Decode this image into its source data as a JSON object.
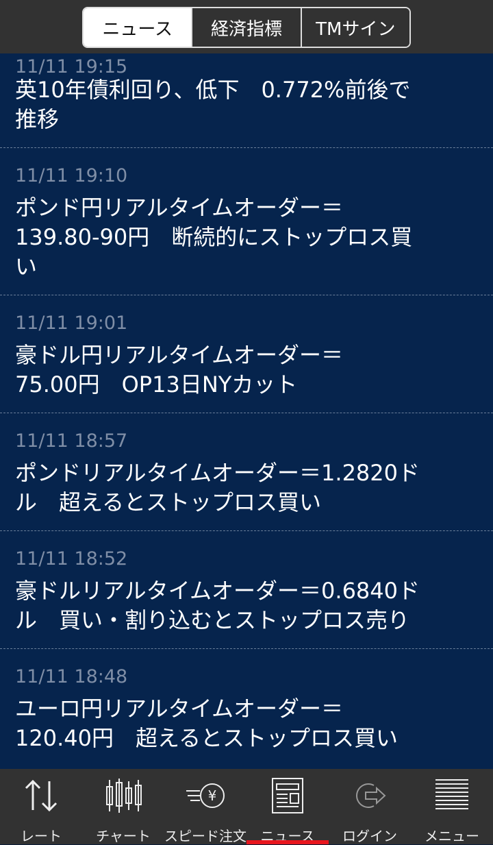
{
  "header": {
    "segments": [
      "ニュース",
      "経済指標",
      "TMサイン"
    ]
  },
  "news": [
    {
      "time": "11/11 19:15",
      "lines": [
        "英10年債利回り、低下　0.772%前後で",
        "推移"
      ]
    },
    {
      "time": "11/11 19:10",
      "lines": [
        "ポンド円リアルタイムオーダー＝",
        "139.80-90円　断続的にストップロス買",
        "い"
      ]
    },
    {
      "time": "11/11 19:01",
      "lines": [
        "豪ドル円リアルタイムオーダー＝",
        "75.00円　OP13日NYカット"
      ]
    },
    {
      "time": "11/11 18:57",
      "lines": [
        "ポンドリアルタイムオーダー＝1.2820ド",
        "ル　超えるとストップロス買い"
      ]
    },
    {
      "time": "11/11 18:52",
      "lines": [
        "豪ドルリアルタイムオーダー＝0.6840ド",
        "ル　買い・割り込むとストップロス売り"
      ]
    },
    {
      "time": "11/11 18:48",
      "lines": [
        "ユーロ円リアルタイムオーダー＝",
        "120.40円　超えるとストップロス買い"
      ]
    }
  ],
  "tabs": [
    {
      "label": "レート",
      "icon": "rate-arrows-icon"
    },
    {
      "label": "チャート",
      "icon": "candlestick-icon"
    },
    {
      "label": "スピード注文",
      "icon": "speed-order-yen-icon"
    },
    {
      "label": "ニュース",
      "icon": "newspaper-icon",
      "active": true
    },
    {
      "label": "ログイン",
      "icon": "login-arrow-icon"
    },
    {
      "label": "メニュー",
      "icon": "menu-lines-icon"
    }
  ],
  "colors": {
    "background": "#0b1d3a",
    "item_bg": "#06244d",
    "time_text": "#7f8ea6",
    "bar_bg": "#323232",
    "active_indicator": "#e8161e"
  }
}
